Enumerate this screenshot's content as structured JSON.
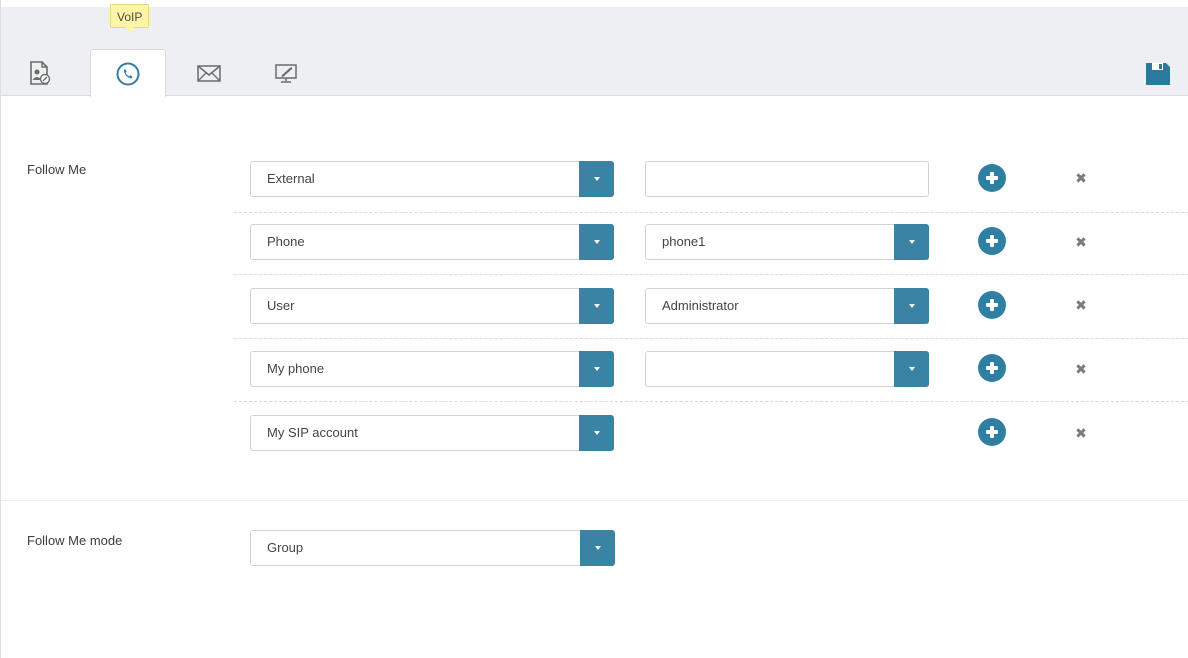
{
  "tabs": [
    {
      "name": "personal-info",
      "icon": "user-card-icon",
      "active": false
    },
    {
      "name": "voip",
      "icon": "phone-icon",
      "active": true
    },
    {
      "name": "mail",
      "icon": "envelope-icon",
      "active": false
    },
    {
      "name": "screen",
      "icon": "monitor-icon",
      "active": false
    }
  ],
  "tooltip": "VoIP",
  "save_icon": "floppy-disk-icon",
  "follow_me": {
    "label": "Follow Me",
    "rows": [
      {
        "type": "External",
        "target_kind": "text",
        "target_value": ""
      },
      {
        "type": "Phone",
        "target_kind": "select",
        "target_value": "phone1"
      },
      {
        "type": "User",
        "target_kind": "select",
        "target_value": "Administrator"
      },
      {
        "type": "My phone",
        "target_kind": "select",
        "target_value": ""
      },
      {
        "type": "My SIP account",
        "target_kind": "none",
        "target_value": ""
      }
    ]
  },
  "follow_me_mode": {
    "label": "Follow Me mode",
    "value": "Group"
  },
  "colors": {
    "accent": "#3b83a5",
    "plus": "#2f7fa3",
    "topbar": "#eeeff2",
    "tooltip": "#fff5a6"
  }
}
